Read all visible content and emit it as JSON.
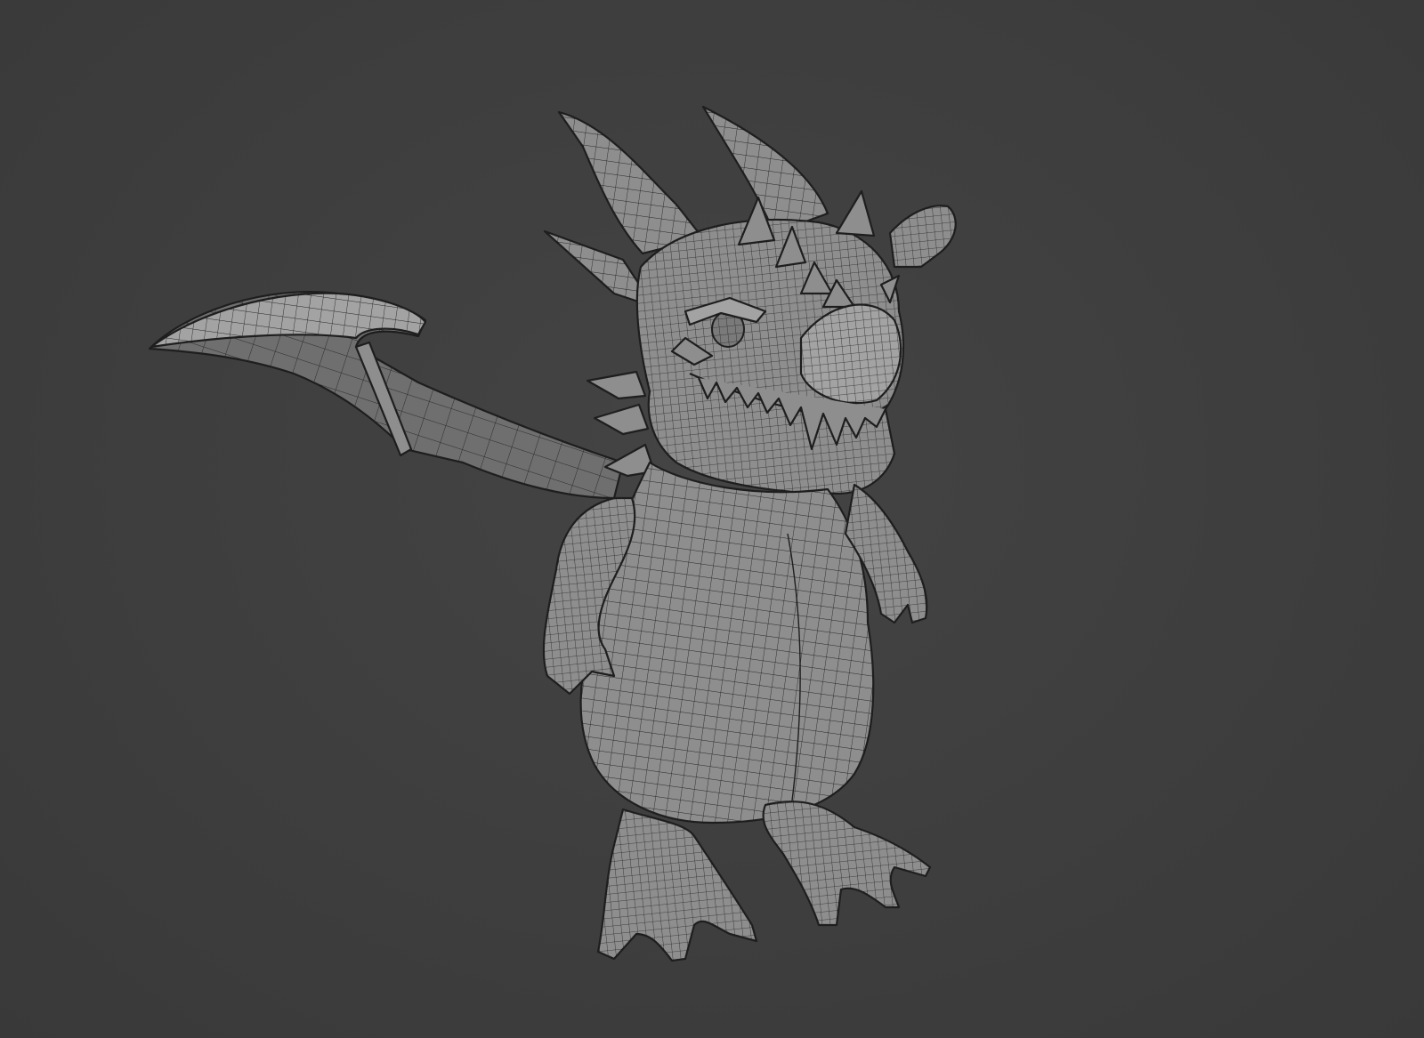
{
  "viewport": {
    "background_color": "#3d3d3d",
    "shading": "solid",
    "overlay": "wireframe"
  },
  "model": {
    "mesh_color": "#8e8e8e",
    "wire_color": "#1e1e1e"
  }
}
